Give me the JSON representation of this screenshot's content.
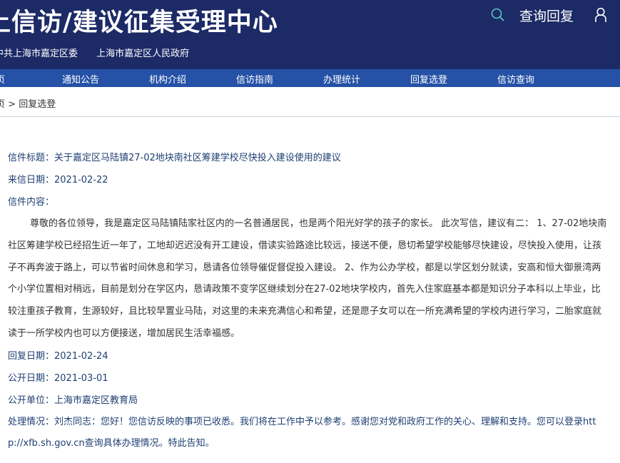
{
  "header": {
    "title": "上信访/建议征集受理中心",
    "query_reply": "查询回复",
    "org_links": [
      "中共上海市嘉定区委",
      "上海市嘉定区人民政府"
    ]
  },
  "nav": {
    "items": [
      "页",
      "通知公告",
      "机构介绍",
      "信访指南",
      "办理统计",
      "回复选登",
      "信访查询"
    ]
  },
  "breadcrumb": {
    "home": "页",
    "separator": ">",
    "current": "回复选登"
  },
  "letter": {
    "title_label": "信件标题：",
    "title_value": "关于嘉定区马陆镇27-02地块南社区筹建学校尽快投入建设使用的建议",
    "date_label": "来信日期：",
    "date_value": "2021-02-22",
    "content_label": "信件内容：",
    "content_text": "尊敬的各位领导，我是嘉定区马陆镇陆家社区内的一名普通居民，也是两个阳光好学的孩子的家长。 此次写信，建议有二： 1、27-02地块南社区筹建学校已经招生近一年了，工地却迟迟没有开工建设，借读实验路途比较远，接送不便，恳切希望学校能够尽快建设，尽快投入使用，让孩子不再奔波于路上，可以节省时间休息和学习，恳请各位领导催促督促投入建设。 2、作为公办学校，都是以学区划分就读，安高和恒大御景湾两个小学位置相对稍远，目前是划分在学区内，恳请政策不变学区继续划分在27-02地块学校内，首先入住家庭基本都是知识分子本科以上毕业，比较注重孩子教育，生源较好，且比较早置业马陆，对这里的未来充满信心和希望，还是愿子女可以在一所充满希望的学校内进行学习，二胎家庭就读于一所学校内也可以方便接送，增加居民生活幸福感。",
    "reply_date_label": "回复日期：",
    "reply_date_value": "2021-02-24",
    "public_date_label": "公开日期：",
    "public_date_value": "2021-03-01",
    "unit_label": "公开单位：",
    "unit_value": "上海市嘉定区教育局",
    "handling_label": "处理情况：",
    "handling_value": "刘杰同志：您好！您信访反映的事项已收悉。我们将在工作中予以参考。感谢您对党和政府工作的关心、理解和支持。您可以登录http://xfb.sh.gov.cn查询具体办理情况。特此告知。"
  },
  "colors": {
    "header_bg": "#1c2a66",
    "nav_bg": "#2552a6",
    "label_text": "#1f3f73",
    "body_text": "#333333"
  }
}
